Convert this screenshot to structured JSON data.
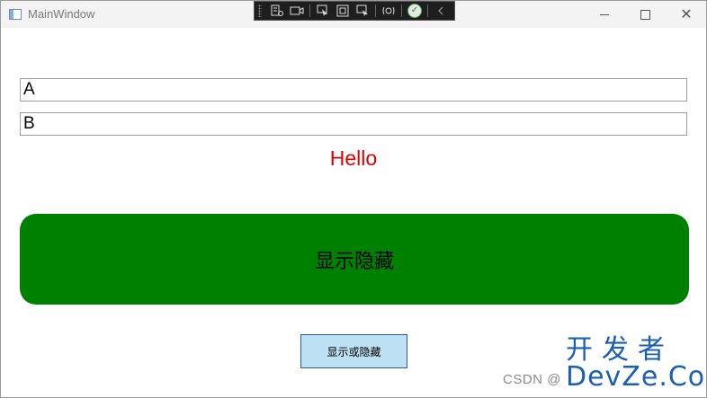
{
  "window": {
    "title": "MainWindow",
    "controls": {
      "minimize": "—",
      "maximize": "☐",
      "close": "✕"
    }
  },
  "debug_toolbar": {
    "icons": [
      "live-visual-tree-icon",
      "camera-icon",
      "select-element-icon",
      "display-layout-adorners-icon",
      "track-focus-icon",
      "hot-reload-icon",
      "check-icon",
      "collapse-icon"
    ]
  },
  "textboxes": {
    "a_value": "A",
    "b_value": "B"
  },
  "hello_label": "Hello",
  "green_button_label": "显示隐藏",
  "toggle_button_label": "显示或隐藏",
  "watermark": {
    "csdn": "CSDN @",
    "brand_cn": "开发者",
    "brand_en": "DevZe.CoM"
  },
  "colors": {
    "hello": "#e00000",
    "green_button": "#008000",
    "toggle_button": "#bee0f3",
    "watermark": "#1a5fb4"
  }
}
